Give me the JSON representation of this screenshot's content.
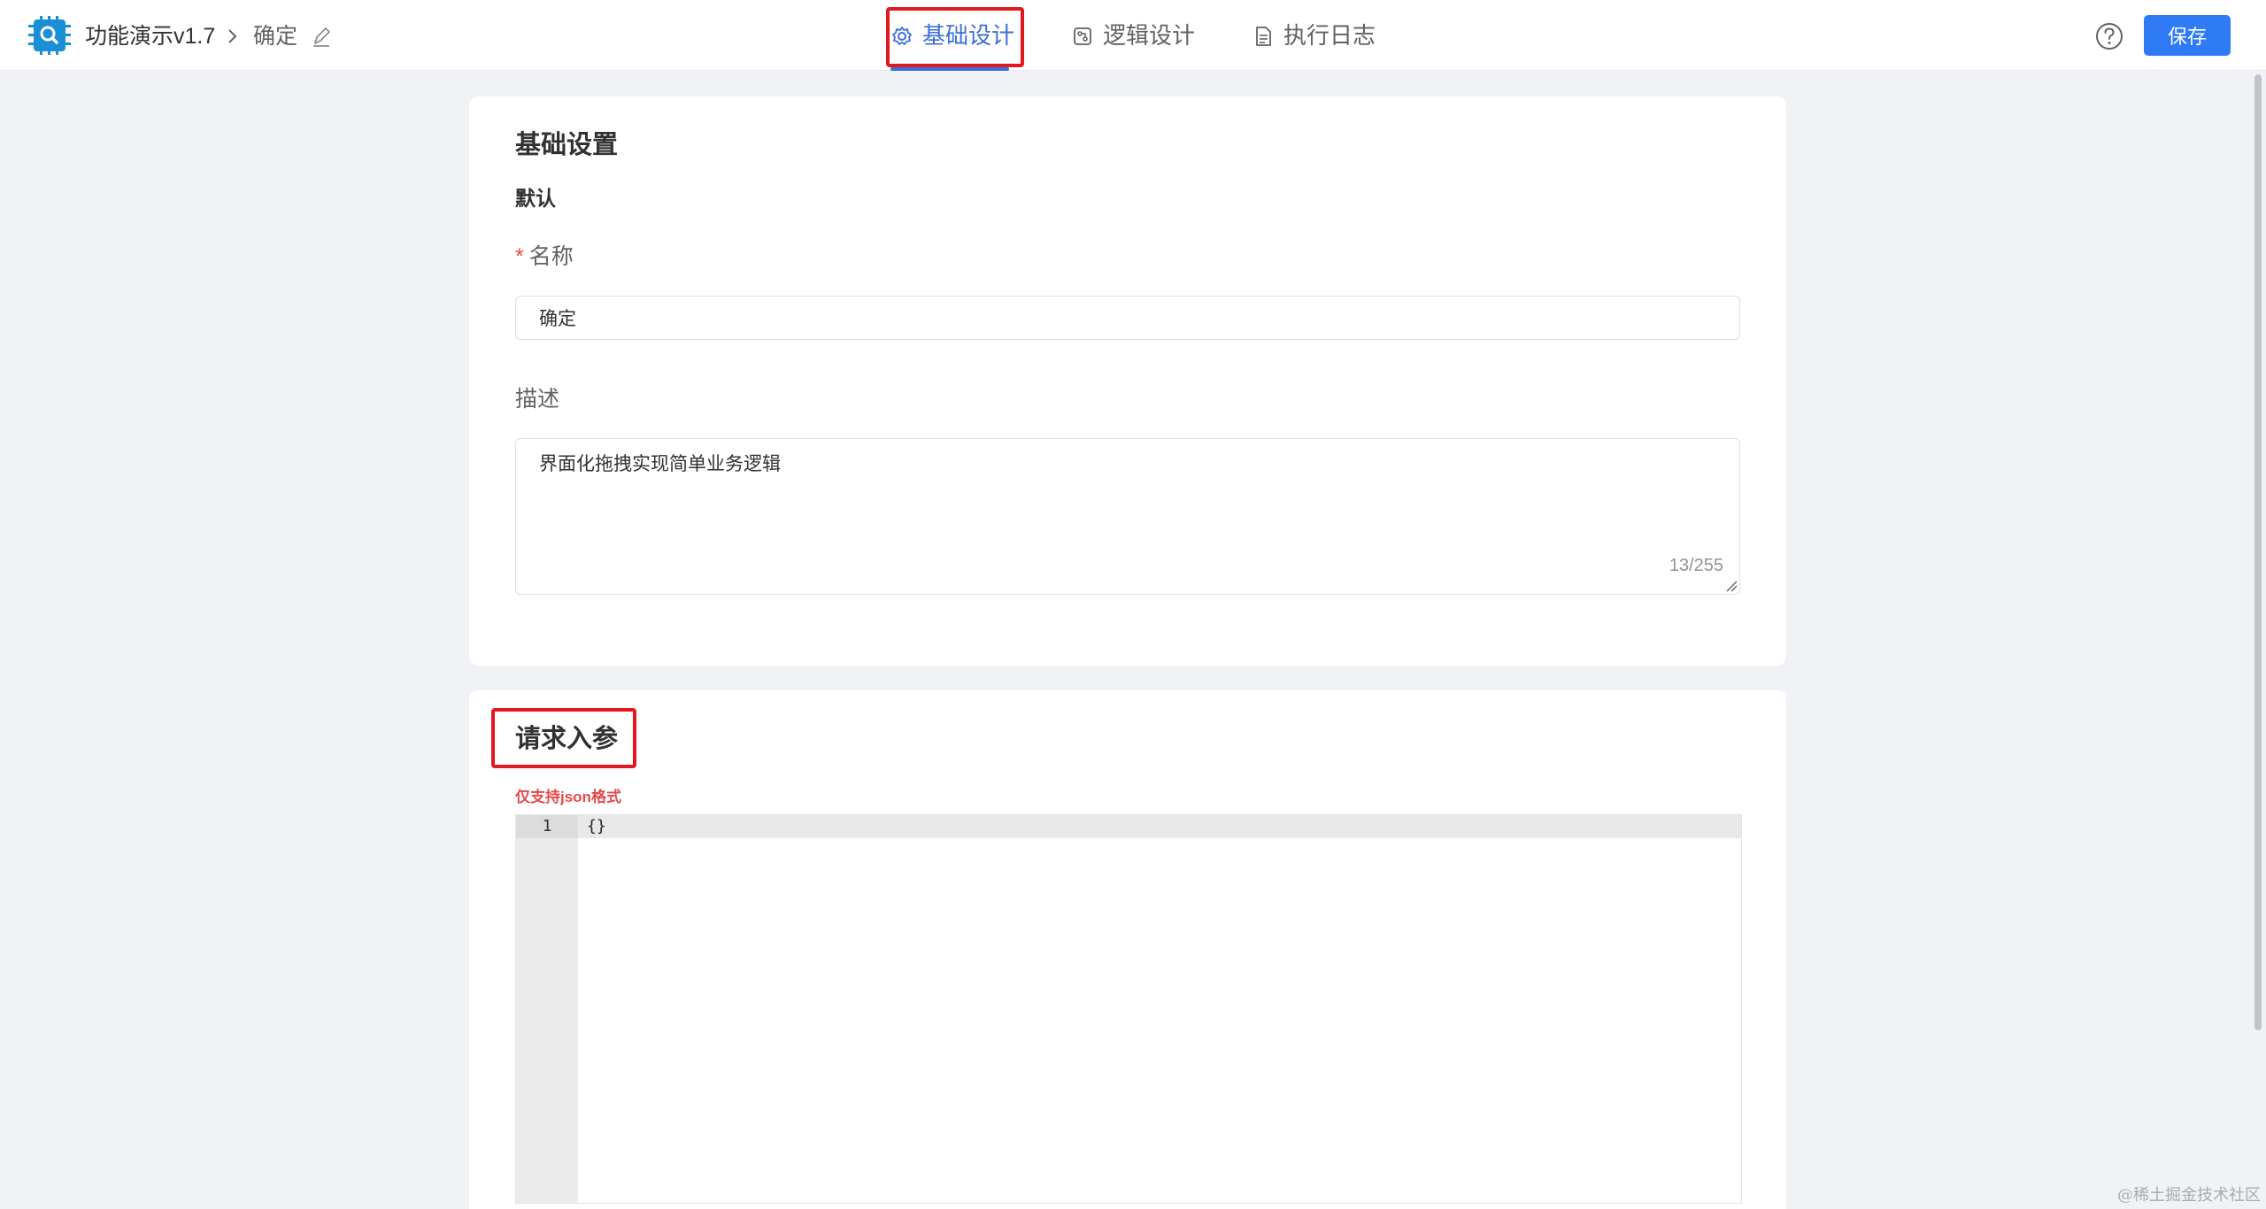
{
  "header": {
    "app_title": "功能演示v1.7",
    "crumb_current": "确定",
    "tabs": [
      {
        "label": "基础设计",
        "icon": "gear-icon",
        "active": true
      },
      {
        "label": "逻辑设计",
        "icon": "logic-icon",
        "active": false
      },
      {
        "label": "执行日志",
        "icon": "document-icon",
        "active": false
      }
    ],
    "save_label": "保存"
  },
  "basic_settings": {
    "title": "基础设置",
    "group": "默认",
    "name_label": "名称",
    "required_mark": "*",
    "name_value": "确定",
    "desc_label": "描述",
    "desc_value": "界面化拖拽实现简单业务逻辑",
    "desc_counter": "13/255"
  },
  "request_params": {
    "title": "请求入参",
    "hint": "仅支持json格式",
    "editor_lines": [
      {
        "number": "1",
        "text": "{}"
      }
    ]
  },
  "watermark": "@稀土掘金技术社区",
  "colors": {
    "accent": "#3b6fd8",
    "save_button": "#2f7bf5",
    "highlight_box": "#e1191e",
    "hint_text": "#e6494b"
  }
}
